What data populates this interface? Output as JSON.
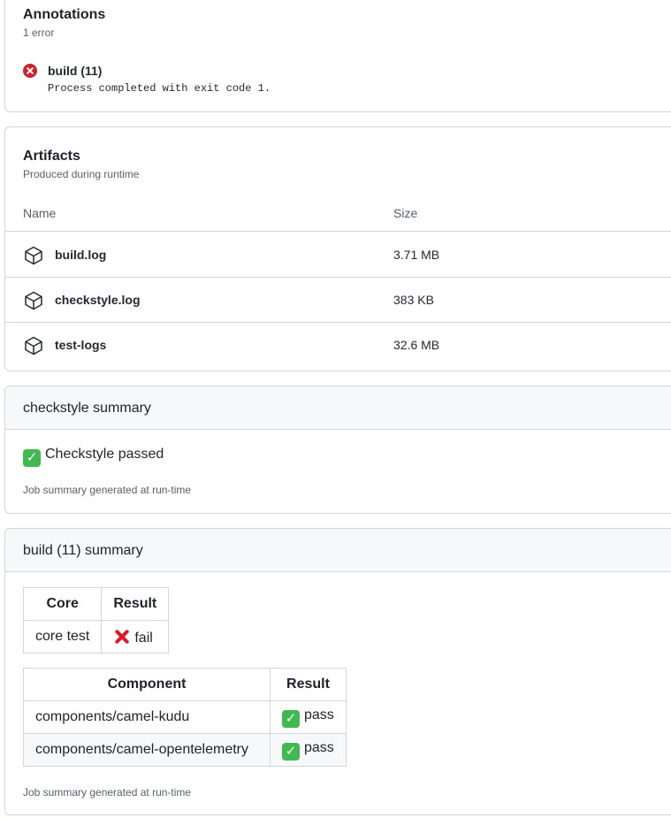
{
  "annotations": {
    "title": "Annotations",
    "subtitle": "1 error",
    "items": [
      {
        "title": "build (11)",
        "message": "Process completed with exit code 1."
      }
    ]
  },
  "artifacts": {
    "title": "Artifacts",
    "subtitle": "Produced during runtime",
    "columns": {
      "name": "Name",
      "size": "Size"
    },
    "rows": [
      {
        "name": "build.log",
        "size": "3.71 MB"
      },
      {
        "name": "checkstyle.log",
        "size": "383 KB"
      },
      {
        "name": "test-logs",
        "size": "32.6 MB"
      }
    ]
  },
  "checkstyle_summary": {
    "title": "checkstyle summary",
    "status_text": "Checkstyle passed",
    "footnote": "Job summary generated at run-time"
  },
  "build_summary": {
    "title": "build (11) summary",
    "core_table": {
      "headers": [
        "Core",
        "Result"
      ],
      "rows": [
        {
          "name": "core test",
          "result": "fail"
        }
      ]
    },
    "component_table": {
      "headers": [
        "Component",
        "Result"
      ],
      "rows": [
        {
          "name": "components/camel-kudu",
          "result": "pass"
        },
        {
          "name": "components/camel-opentelemetry",
          "result": "pass"
        }
      ]
    },
    "footnote": "Job summary generated at run-time"
  },
  "colors": {
    "error": "#cf222e",
    "success": "#3fb950",
    "fail_cross": "#e0162b",
    "border": "#d0d7de",
    "header_bg": "#f6f8fa"
  }
}
